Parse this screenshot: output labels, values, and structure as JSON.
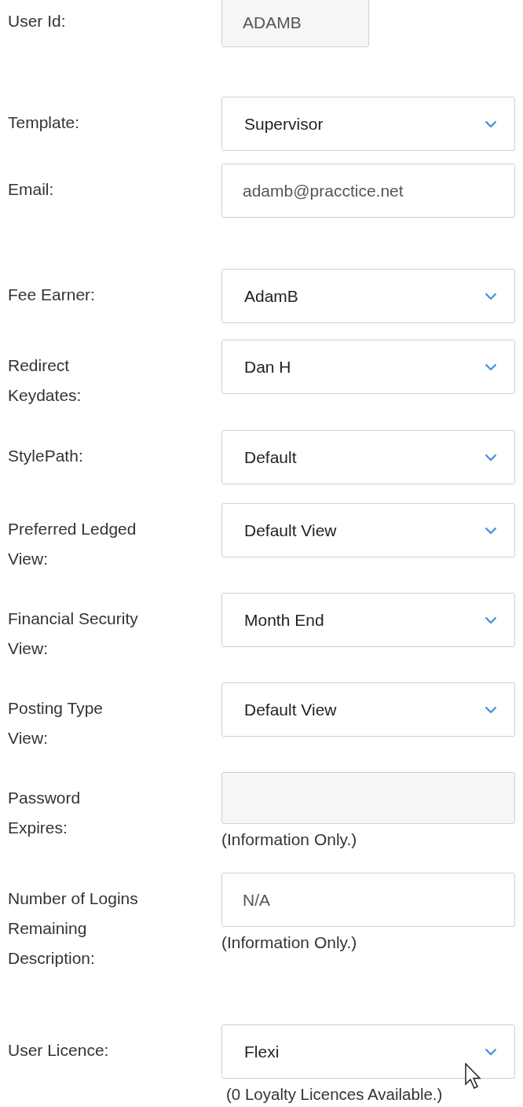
{
  "fields": [
    {
      "label": "User Id:",
      "kind": "text",
      "value": "ADAMB",
      "disabled": true,
      "compact": true
    },
    {
      "label": "Template:",
      "kind": "select",
      "value": "Supervisor",
      "disabled": false
    },
    {
      "label": "Email:",
      "kind": "text",
      "value": "adamb@pracctice.net",
      "disabled": false
    },
    {
      "label": "Fee Earner:",
      "kind": "select",
      "value": "AdamB",
      "disabled": false
    },
    {
      "label": "Redirect Keydates:",
      "kind": "select",
      "value": "Dan H",
      "disabled": false
    },
    {
      "label": "StylePath:",
      "kind": "select",
      "value": "Default",
      "disabled": false
    },
    {
      "label": "Preferred Ledged View:",
      "kind": "select",
      "value": "Default View",
      "disabled": false
    },
    {
      "label": "Financial Security View:",
      "kind": "select",
      "value": "Month End",
      "disabled": false
    },
    {
      "label": "Posting Type View:",
      "kind": "select",
      "value": "Default View",
      "disabled": false
    },
    {
      "label": "Password Expires:",
      "kind": "text",
      "disabled": true,
      "note": "(Information Only.)"
    },
    {
      "label": "Number of Logins Remaining Description:",
      "kind": "text",
      "placeholder": "N/A",
      "disabled": false,
      "note": "(Information Only.)"
    },
    {
      "label": "User Licence:",
      "kind": "select",
      "value": "Flexi",
      "disabled": false,
      "note": "(0 Loyalty Licences Available.)"
    }
  ]
}
